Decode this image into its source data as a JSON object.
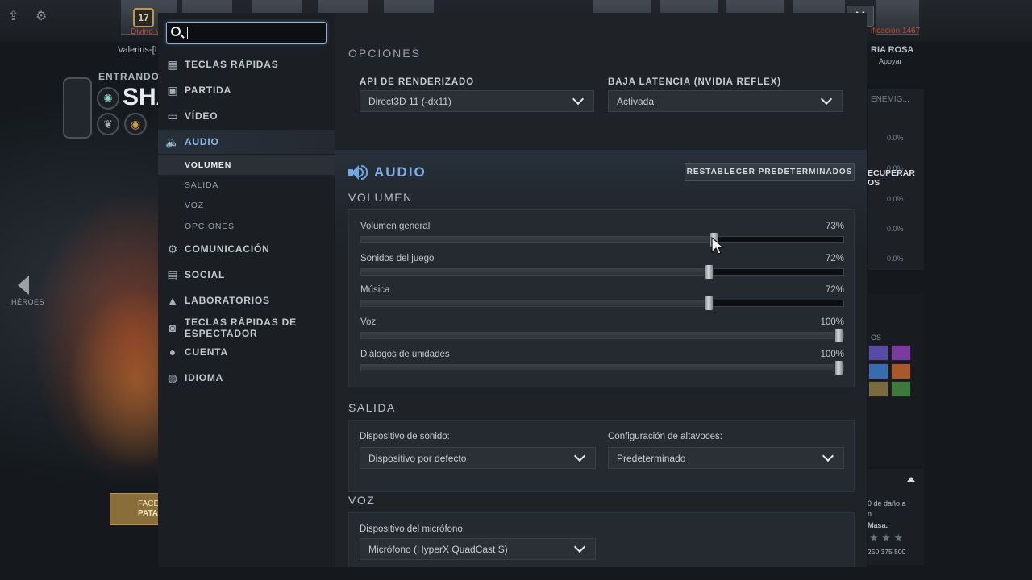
{
  "background": {
    "level": "17",
    "player_rank": "Divino V",
    "player_name": "Valerius-[I",
    "entering_text": "ENTRANDO E",
    "hero_partial": "SHA",
    "heroes_label": "HÉROES",
    "facet_line1": "FACE",
    "facet_line2": "PATA",
    "right_rank": "ificación 1467",
    "right_name": "RIA ROSA",
    "support_label": "Apoyar",
    "enemies_label": "ENEMIG...",
    "recover_line1": "ECUPERAR",
    "recover_line2": "OS",
    "pct_values": [
      "0.0%",
      "0.0%",
      "0.0%",
      "0.0%",
      "0.0%"
    ],
    "items_label": "OS",
    "damage_text_1": "0 de daño a",
    "damage_text_2": "n",
    "damage_text_3": "Masa.",
    "stars": "★ ★ ★",
    "numbers_row": "250  375  500"
  },
  "search": {
    "value": "",
    "placeholder": ""
  },
  "sidebar": {
    "items": [
      {
        "label": "TECLAS RÁPIDAS",
        "icon": "grid-icon"
      },
      {
        "label": "PARTIDA",
        "icon": "match-icon"
      },
      {
        "label": "VÍDEO",
        "icon": "monitor-icon"
      },
      {
        "label": "AUDIO",
        "icon": "speaker-icon"
      },
      {
        "label": "COMUNICACIÓN",
        "icon": "gear-icon"
      },
      {
        "label": "SOCIAL",
        "icon": "chat-icon"
      },
      {
        "label": "LABORATORIOS",
        "icon": "flask-icon"
      },
      {
        "label": "TECLAS RÁPIDAS DE ESPECTADOR",
        "icon": "camera-icon"
      },
      {
        "label": "CUENTA",
        "icon": "user-icon"
      },
      {
        "label": "IDIOMA",
        "icon": "globe-icon"
      }
    ],
    "audio_sub": [
      "VOLUMEN",
      "SALIDA",
      "VOZ",
      "OPCIONES"
    ]
  },
  "options_section": {
    "title": "OPCIONES",
    "render_api_label": "API DE RENDERIZADO",
    "render_api_value": "Direct3D 11 (-dx11)",
    "low_latency_label": "BAJA LATENCIA (NVIDIA REFLEX)",
    "low_latency_value": "Activada"
  },
  "audio": {
    "title": "AUDIO",
    "reset_label": "RESTABLECER PREDETERMINADOS",
    "volume_title": "VOLUMEN",
    "sliders": [
      {
        "name": "Volumen general",
        "pct_text": "73%",
        "value": 0.73
      },
      {
        "name": "Sonidos del juego",
        "pct_text": "72%",
        "value": 0.72
      },
      {
        "name": "Música",
        "pct_text": "72%",
        "value": 0.72
      },
      {
        "name": "Voz",
        "pct_text": "100%",
        "value": 1.0
      },
      {
        "name": "Diálogos de unidades",
        "pct_text": "100%",
        "value": 1.0
      }
    ],
    "output_title": "SALIDA",
    "sound_device_label": "Dispositivo de sonido:",
    "sound_device_value": "Dispositivo por defecto",
    "speaker_config_label": "Configuración de altavoces:",
    "speaker_config_value": "Predeterminado",
    "voice_title": "VOZ",
    "mic_label": "Dispositivo del micrófono:",
    "mic_value": "Micrófono (HyperX QuadCast S)"
  },
  "colors": {
    "accent": "#7db0ea",
    "panel": "#1f2328",
    "sidebar": "#1b1f24"
  }
}
